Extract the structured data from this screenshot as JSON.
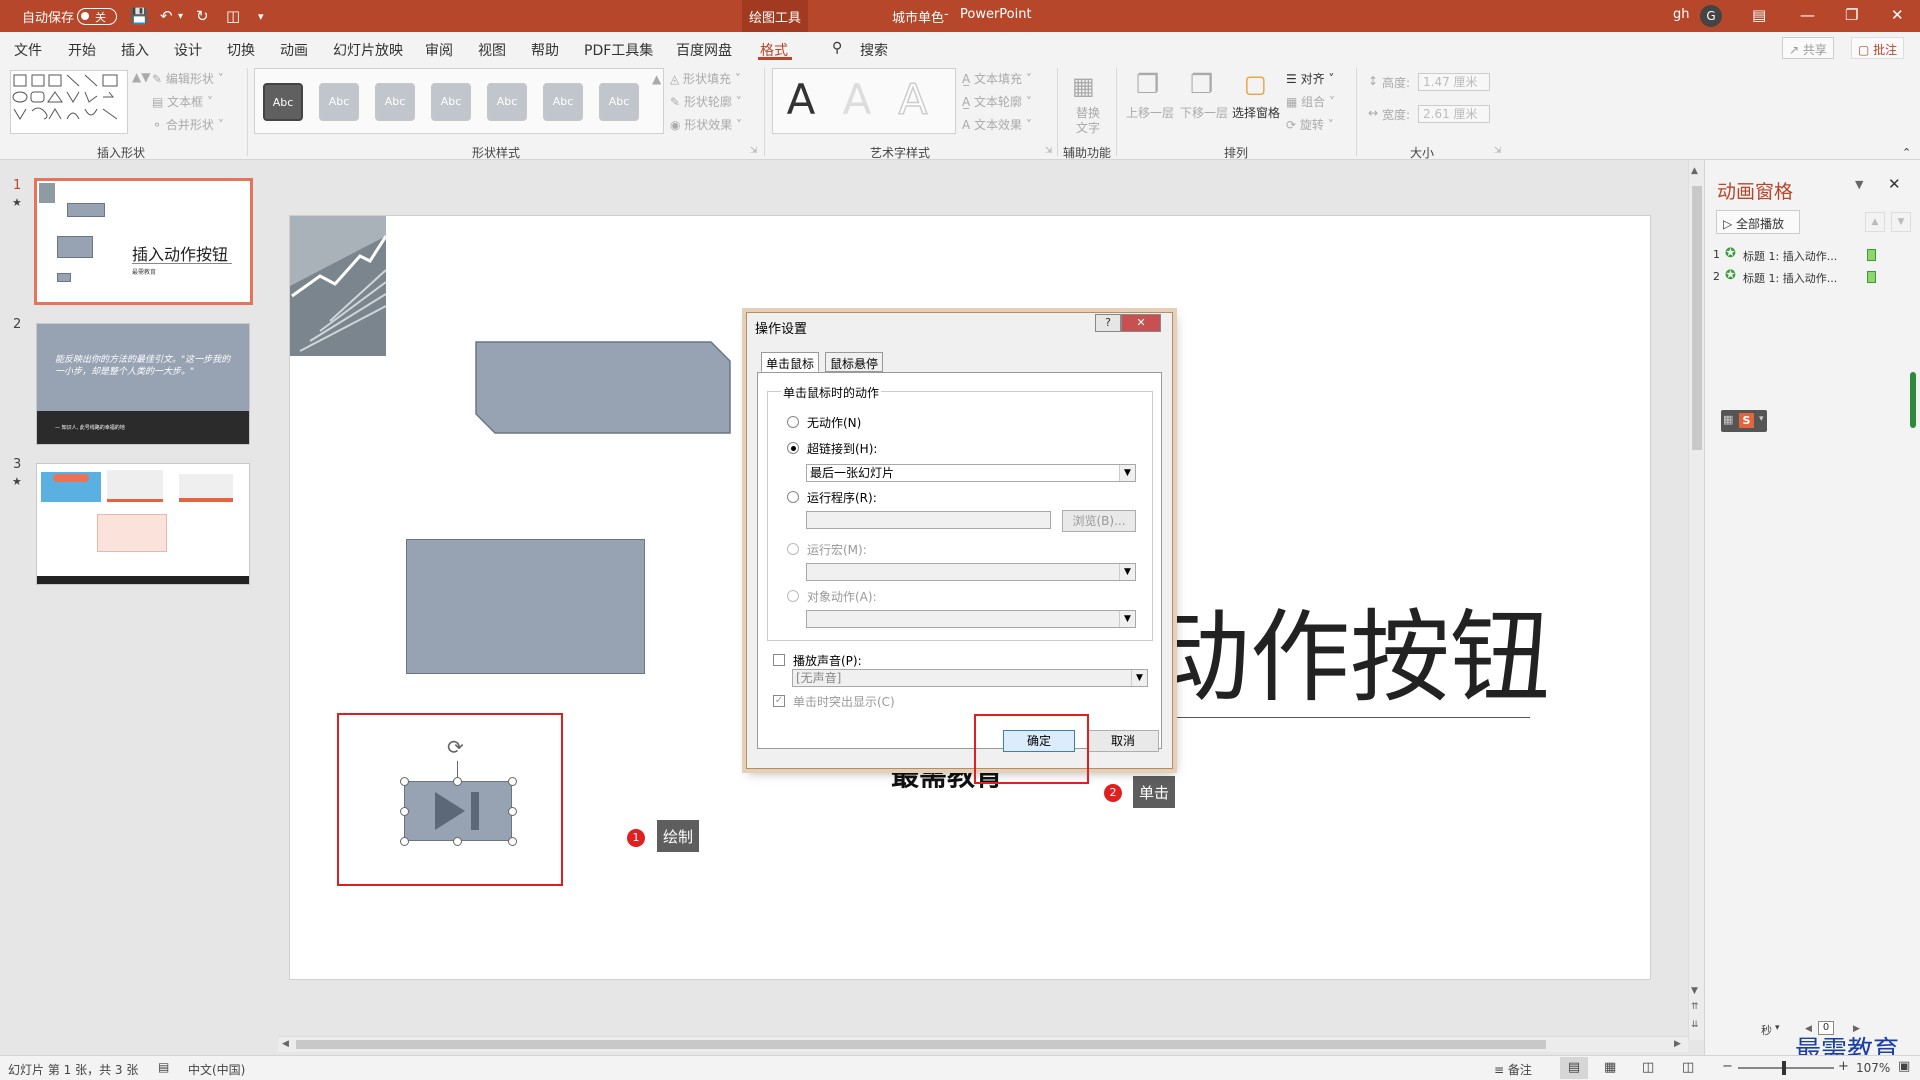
{
  "titlebar": {
    "autosave_label": "自动保存",
    "autosave_state": "关",
    "context_tab": "绘图工具",
    "doc_title": "城市单色",
    "app_name": "PowerPoint",
    "user_initials": "gh",
    "user_avatar": "G"
  },
  "menu": {
    "tabs": [
      "文件",
      "开始",
      "插入",
      "设计",
      "切换",
      "动画",
      "幻灯片放映",
      "审阅",
      "视图",
      "帮助",
      "PDF工具集",
      "百度网盘",
      "格式"
    ],
    "search": "搜索",
    "share": "共享",
    "comment": "批注"
  },
  "ribbon": {
    "insert_shapes": {
      "label": "插入形状",
      "edit_shape": "编辑形状",
      "text_box": "文本框",
      "merge_shapes": "合并形状"
    },
    "shape_styles": {
      "label": "形状样式",
      "sample": "Abc",
      "fill": "形状填充",
      "outline": "形状轮廓",
      "effects": "形状效果"
    },
    "wordart": {
      "label": "艺术字样式",
      "sample": "A",
      "text_fill": "文本填充",
      "text_outline": "文本轮廓",
      "text_effects": "文本效果"
    },
    "accessibility": {
      "label": "辅助功能",
      "alt_text_1": "替换",
      "alt_text_2": "文字"
    },
    "arrange": {
      "label": "排列",
      "bring_forward": "上移一层",
      "send_backward": "下移一层",
      "selection_pane": "选择窗格",
      "align": "对齐",
      "group": "组合",
      "rotate": "旋转"
    },
    "size": {
      "label": "大小",
      "height_label": "高度:",
      "height_value": "1.47 厘米",
      "width_label": "宽度:",
      "width_value": "2.61 厘米"
    }
  },
  "slides": [
    {
      "num": "1",
      "has_anim": true,
      "title": "插入动作按钮",
      "subtitle": "最需教育"
    },
    {
      "num": "2",
      "has_anim": false,
      "quote": "能反映出你的方法的最佳引文。\"这一步我的一小步，却是整个人类的一大步。\"",
      "footer": "— 知识人, 此号线路的幸福的地"
    },
    {
      "num": "3",
      "has_anim": true
    }
  ],
  "main_slide": {
    "title_visible": "动作按钮",
    "subtitle_visible": "最需教育"
  },
  "annotations": {
    "step1_num": "1",
    "step1_text": "绘制",
    "step2_num": "2",
    "step2_text": "单击"
  },
  "dialog": {
    "title": "操作设置",
    "help": "?",
    "close": "✕",
    "tab_click": "单击鼠标",
    "tab_hover": "鼠标悬停",
    "group_title": "单击鼠标时的动作",
    "no_action": "无动作(N)",
    "hyperlink": "超链接到(H):",
    "hyperlink_value": "最后一张幻灯片",
    "run_program": "运行程序(R):",
    "browse": "浏览(B)...",
    "run_macro": "运行宏(M):",
    "object_action": "对象动作(A):",
    "play_sound": "播放声音(P):",
    "sound_value": "[无声音]",
    "highlight": "单击时突出显示(C)",
    "ok": "确定",
    "cancel": "取消"
  },
  "animation_pane": {
    "title": "动画窗格",
    "play_all": "全部播放",
    "items": [
      {
        "num": "1",
        "text": "标题 1: 插入动作..."
      },
      {
        "num": "2",
        "text": "标题 1: 插入动作..."
      }
    ],
    "seconds_label": "秒",
    "timeline_zero": "0"
  },
  "statusbar": {
    "slide_info": "幻灯片 第 1 张，共 3 张",
    "language": "中文(中国)",
    "notes": "备注",
    "zoom": "107%"
  },
  "watermark": "最需教育",
  "colors": {
    "accent": "#b7472a",
    "shape": "#97a3b3",
    "annotation_red": "#e02020"
  }
}
